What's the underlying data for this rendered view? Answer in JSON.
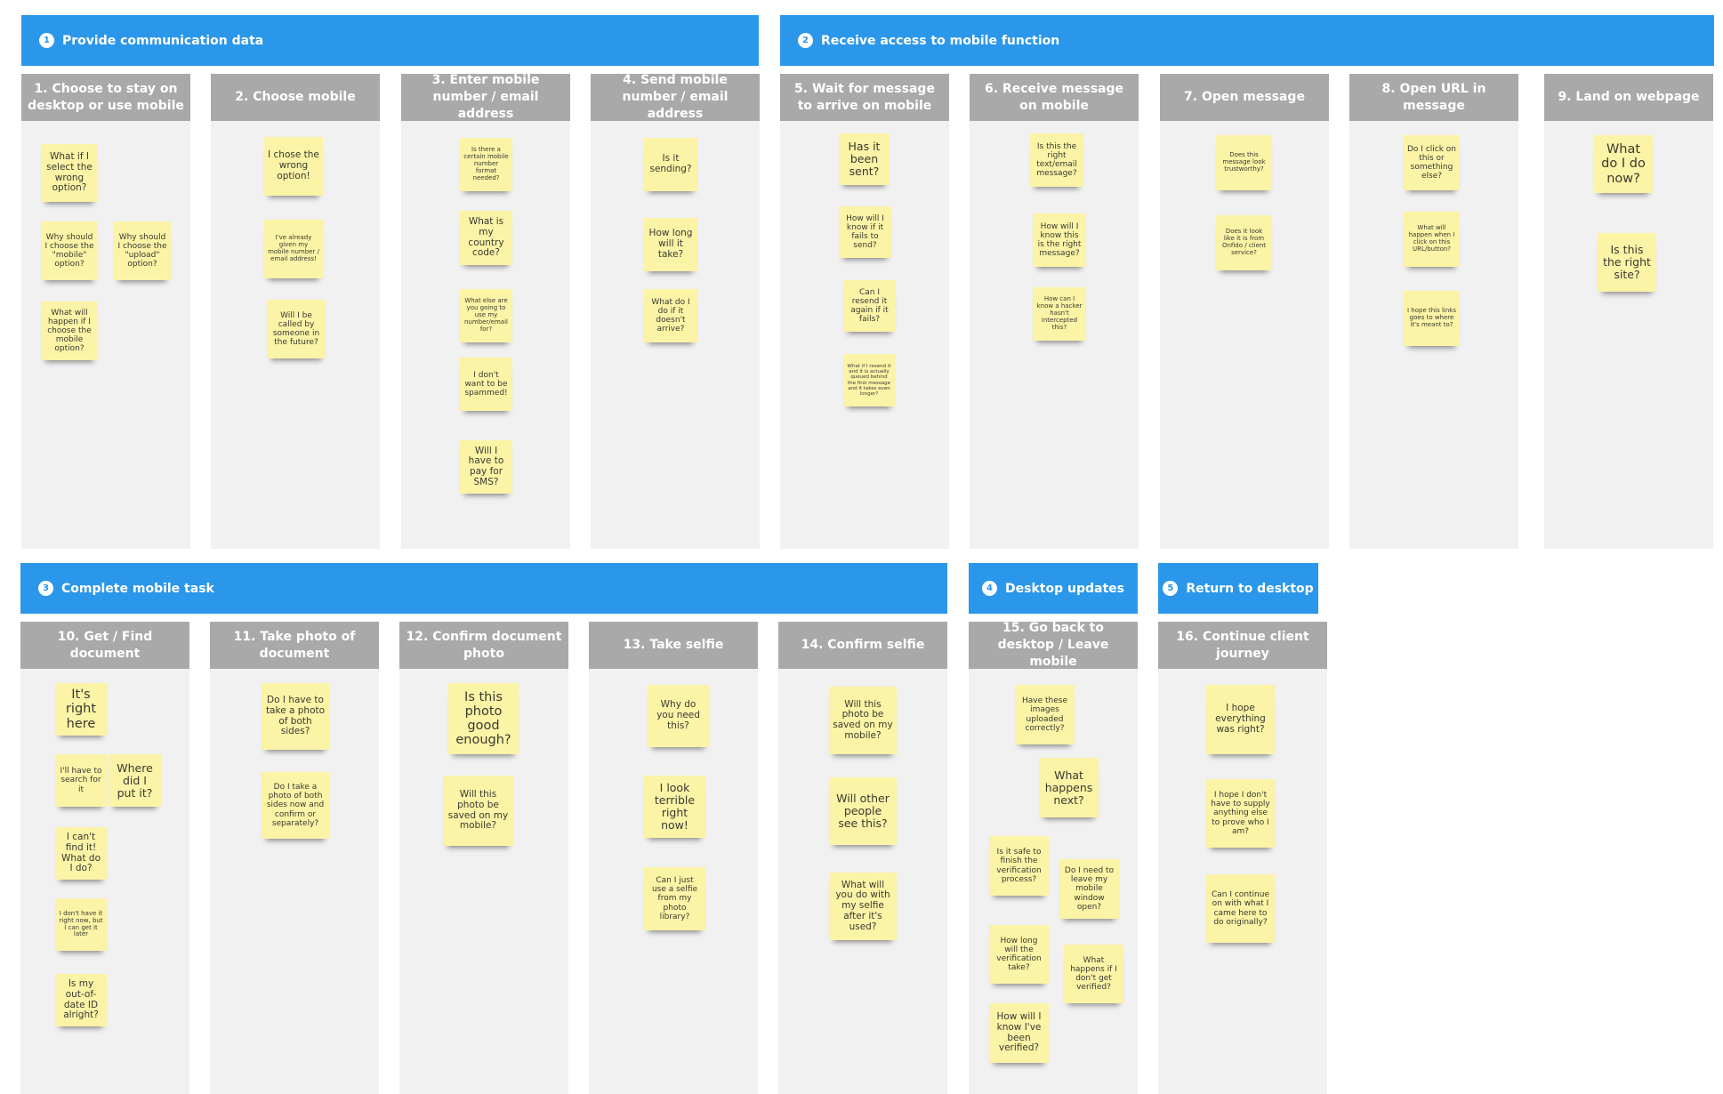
{
  "phases": [
    {
      "number": "1",
      "title": "Provide communication data"
    },
    {
      "number": "2",
      "title": "Receive access to mobile function"
    },
    {
      "number": "3",
      "title": "Complete mobile task"
    },
    {
      "number": "4",
      "title": "Desktop updates"
    },
    {
      "number": "5",
      "title": "Return to desktop"
    }
  ],
  "steps": [
    {
      "title": "1. Choose to stay on desktop or use mobile",
      "notes": [
        "What if I select the wrong option?",
        "Why should I choose the \"mobile\" option?",
        "Why should I choose the \"upload\" option?",
        "What will happen if I choose the mobile option?"
      ]
    },
    {
      "title": "2. Choose mobile",
      "notes": [
        "I chose the wrong option!",
        "I've already given my mobile number / email address!",
        "Will I be called by someone in the future?"
      ]
    },
    {
      "title": "3. Enter mobile number / email address",
      "notes": [
        "Is there a certain mobile number format needed?",
        "What is my country code?",
        "What else are you going to use my number/email for?",
        "I don't want to be spammed!",
        "Will I have to pay for SMS?"
      ]
    },
    {
      "title": "4. Send mobile number / email address",
      "notes": [
        "Is it sending?",
        "How long will it take?",
        "What do I do if it doesn't arrive?"
      ]
    },
    {
      "title": "5. Wait for message to arrive on mobile",
      "notes": [
        "Has it been sent?",
        "How will I know if it fails to send?",
        "Can I resend it again if it fails?",
        "What if I resend it and it is actually queued behind the first message and it takes even longer?"
      ]
    },
    {
      "title": "6. Receive message on mobile",
      "notes": [
        "Is this the right text/email message?",
        "How will I know this is the right message?",
        "How can I know a hacker hasn't intercepted this?"
      ]
    },
    {
      "title": "7. Open message",
      "notes": [
        "Does this message look trustworthy?",
        "Does it look like it is from Onfido / client service?"
      ]
    },
    {
      "title": "8. Open URL in message",
      "notes": [
        "Do I click on this or something else?",
        "What will happen when I click on this URL/button?",
        "I hope this links goes to where it's meant to?"
      ]
    },
    {
      "title": "9. Land on webpage",
      "notes": [
        "What do I do now?",
        "Is this the right site?"
      ]
    },
    {
      "title": "10. Get / Find document",
      "notes": [
        "It's right here",
        "I'll have to search for it",
        "Where did I put it?",
        "I can't find it! What do I do?",
        "I don't have it right now, but I can get it later",
        "Is my out-of-date ID alright?"
      ]
    },
    {
      "title": "11. Take photo of document",
      "notes": [
        "Do I have to take a photo of both sides?",
        "Do I take a photo of both sides now and confirm or separately?"
      ]
    },
    {
      "title": "12. Confirm document photo",
      "notes": [
        "Is this photo good enough?",
        "Will this photo be saved on my mobile?"
      ]
    },
    {
      "title": "13. Take selfie",
      "notes": [
        "Why do you need this?",
        "I look terrible right now!",
        "Can I just use a selfie from my photo library?"
      ]
    },
    {
      "title": "14. Confirm selfie",
      "notes": [
        "Will this photo be saved on my mobile?",
        "Will other people see this?",
        "What will you do with my selfie after it's used?"
      ]
    },
    {
      "title": "15. Go back to desktop / Leave mobile",
      "notes": [
        "Have these images uploaded correctly?",
        "What happens next?",
        "Is it safe to finish the verification process?",
        "Do I need to leave my mobile window open?",
        "How long will the verification take?",
        "What happens if I don't get verified?",
        "How will I know I've been verified?"
      ]
    },
    {
      "title": "16. Continue client journey",
      "notes": [
        "I hope everything was right?",
        "I hope I don't have to supply anything else to prove who I am?",
        "Can I continue on with what I came here to do originally?"
      ]
    }
  ],
  "colors": {
    "phase_header": "#2b97ea",
    "step_header": "#a9a9a9",
    "column_bg": "#f1f1f1",
    "sticky": "#fbf3a6"
  }
}
